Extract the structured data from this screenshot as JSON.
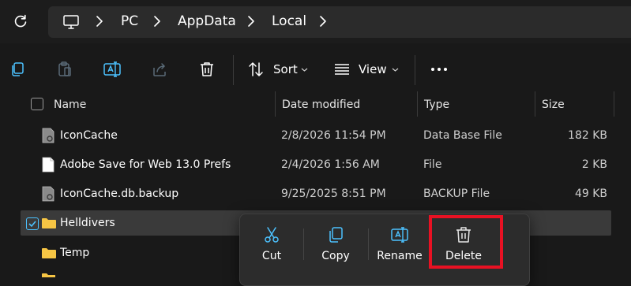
{
  "address_bar": {
    "breadcrumbs": [
      "PC",
      "AppData",
      "Local"
    ]
  },
  "toolbar": {
    "sort_label": "Sort",
    "view_label": "View"
  },
  "columns": {
    "name": "Name",
    "date_modified": "Date modified",
    "type": "Type",
    "size": "Size"
  },
  "files": [
    {
      "name": "IconCache",
      "date": "2/8/2026 11:54 PM",
      "type": "Data Base File",
      "size": "182 KB",
      "icon": "settings-file-icon"
    },
    {
      "name": "Adobe Save for Web 13.0 Prefs",
      "date": "2/4/2026 1:56 AM",
      "type": "File",
      "size": "2 KB",
      "icon": "blank-file-icon"
    },
    {
      "name": "IconCache.db.backup",
      "date": "9/25/2025 8:51 PM",
      "type": "BACKUP File",
      "size": "49 KB",
      "icon": "settings-file-icon"
    },
    {
      "name": "Helldivers",
      "date": "",
      "type": "",
      "size": "",
      "icon": "folder-icon",
      "selected": true
    },
    {
      "name": "Temp",
      "date": "",
      "type": "",
      "size": "",
      "icon": "folder-icon"
    }
  ],
  "context_menu": {
    "cut_label": "Cut",
    "copy_label": "Copy",
    "rename_label": "Rename",
    "delete_label": "Delete"
  },
  "colors": {
    "background": "#191919",
    "address_bar": "#2b2b2b",
    "selected_row": "#3a3a3a",
    "checkbox_accent": "#4cc2ff",
    "folder": "#f6c544",
    "highlight": "#e81123"
  }
}
